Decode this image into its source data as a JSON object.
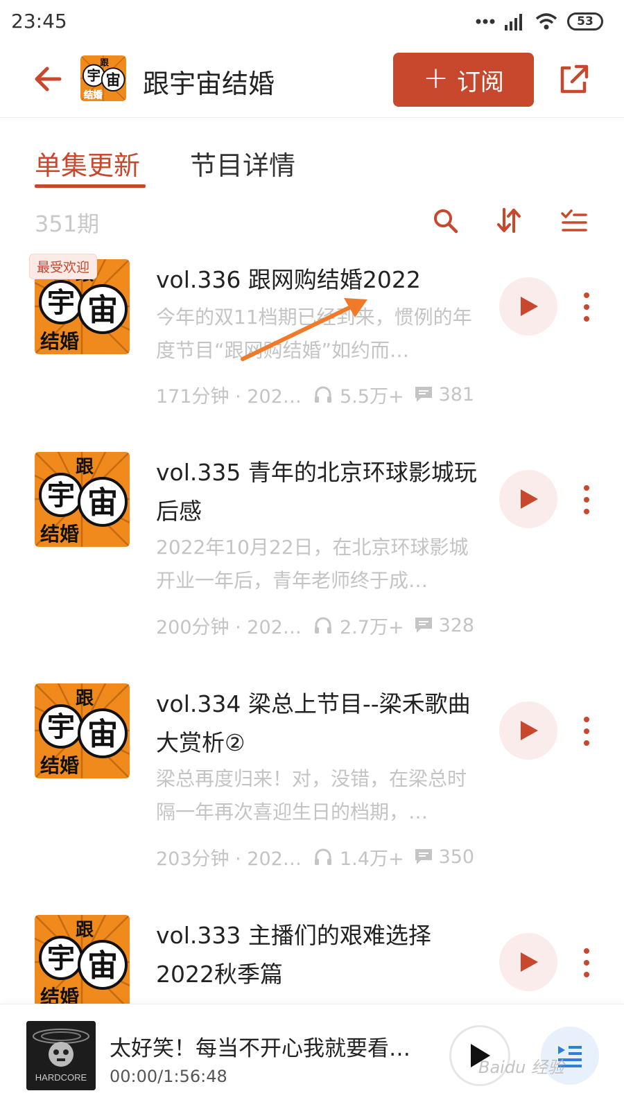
{
  "status_bar": {
    "time": "23:45",
    "battery": "53"
  },
  "header": {
    "title": "跟宇宙结婚",
    "subscribe_label": "订阅"
  },
  "tabs": [
    {
      "label": "单集更新",
      "active": true
    },
    {
      "label": "节目详情",
      "active": false
    }
  ],
  "toolbar": {
    "episode_count": "351期"
  },
  "cover_art": {
    "chars": [
      "跟",
      "宇",
      "宙",
      "结婚"
    ]
  },
  "episodes": [
    {
      "badge": "最受欢迎",
      "title": "vol.336 跟网购结婚2022",
      "desc": "今年的双11档期已经到来，惯例的年度节目“跟网购结婚”如约而…",
      "duration": "171分钟 · 202…",
      "plays": "5.5万+",
      "comments": "381"
    },
    {
      "title": "vol.335 青年的北京环球影城玩后感",
      "desc": "2022年10月22日，在北京环球影城开业一年后，青年老师终于成…",
      "duration": "200分钟 · 202…",
      "plays": "2.7万+",
      "comments": "328"
    },
    {
      "title": "vol.334 梁总上节目--梁禾歌曲大赏析②",
      "desc": "梁总再度归来！对，没错，在梁总时隔一年再次喜迎生日的档期，…",
      "duration": "203分钟 · 202…",
      "plays": "1.4万+",
      "comments": "350"
    },
    {
      "title": "vol.333 主播们的艰难选择2022秋季篇"
    }
  ],
  "mini_player": {
    "title": "太好笑！每当不开心我就要看…",
    "time": "00:00/1:56:48",
    "cover_text": "HARDCORE"
  },
  "watermark": "Baidu 经验",
  "colors": {
    "accent": "#c8482d",
    "muted": "#c4c4c4",
    "cover_orange": "#f08a1c"
  }
}
